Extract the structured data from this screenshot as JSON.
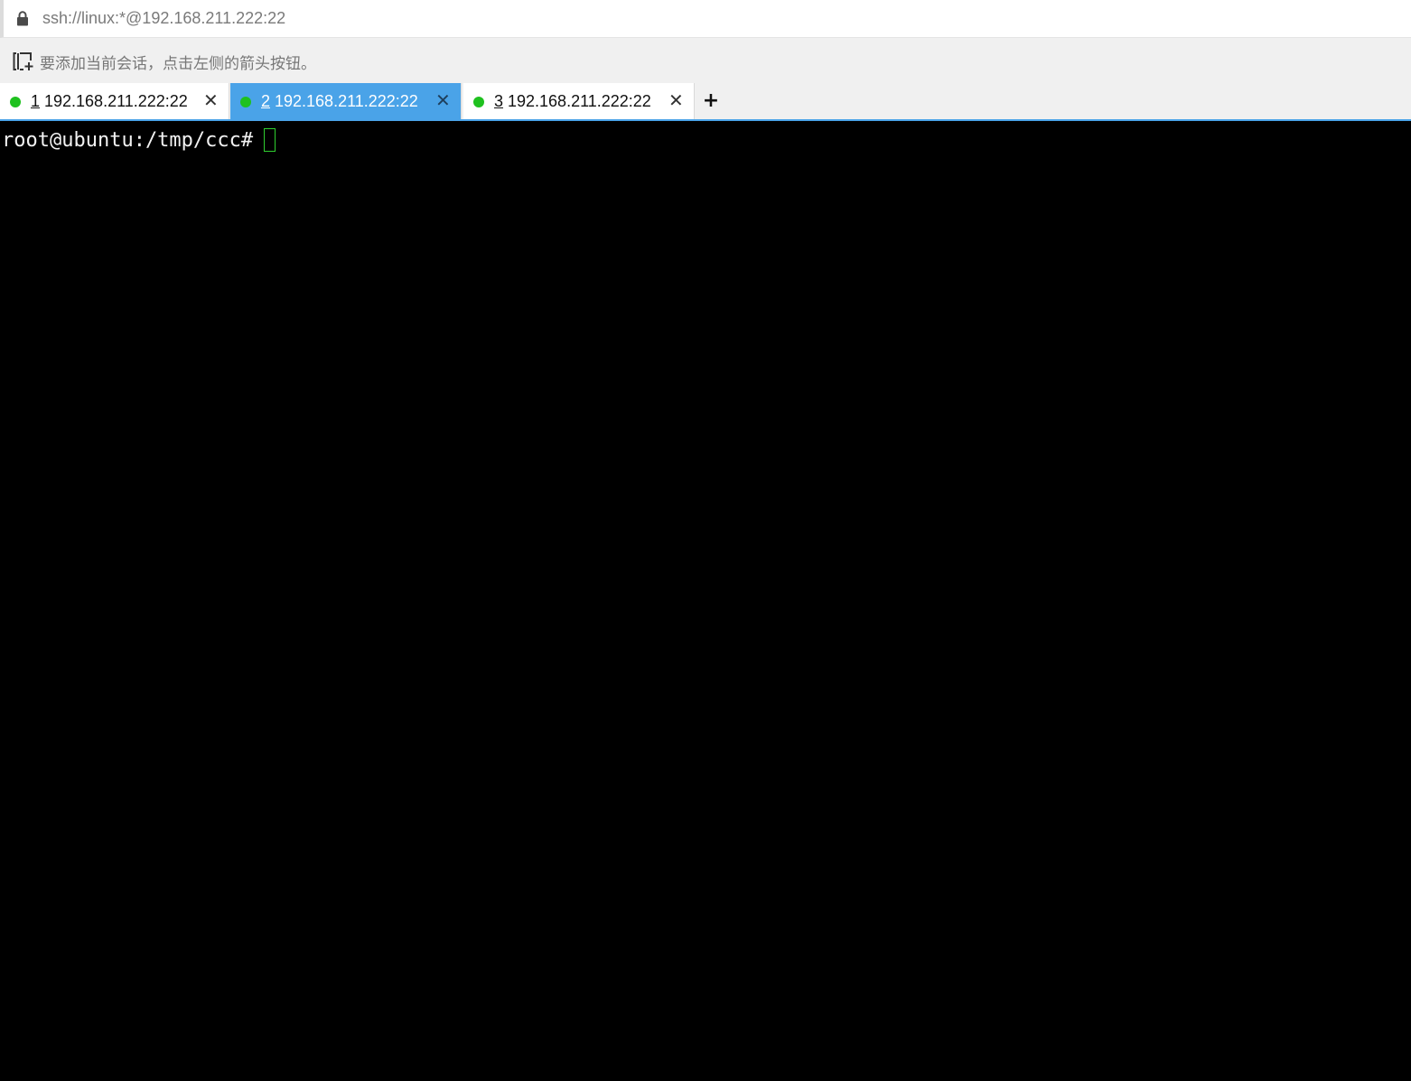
{
  "address_bar": {
    "url": "ssh://linux:*@192.168.211.222:22",
    "lock_icon": "lock-icon"
  },
  "hint_bar": {
    "icon": "add-session-icon",
    "text": "要添加当前会话，点击左侧的箭头按钮。"
  },
  "tabs": [
    {
      "number": "1",
      "label": "192.168.211.222:22",
      "status_color": "#1fc11f",
      "active": false
    },
    {
      "number": "2",
      "label": "192.168.211.222:22",
      "status_color": "#1fc11f",
      "active": true
    },
    {
      "number": "3",
      "label": "192.168.211.222:22",
      "status_color": "#1fc11f",
      "active": false
    }
  ],
  "new_tab": {
    "label": "+"
  },
  "terminal": {
    "prompt": "root@ubuntu:/tmp/ccc#",
    "input": "",
    "cursor_color": "#2fcf2f",
    "background": "#000000"
  },
  "colors": {
    "accent": "#4aa3e8",
    "status_connected": "#1fc11f"
  }
}
